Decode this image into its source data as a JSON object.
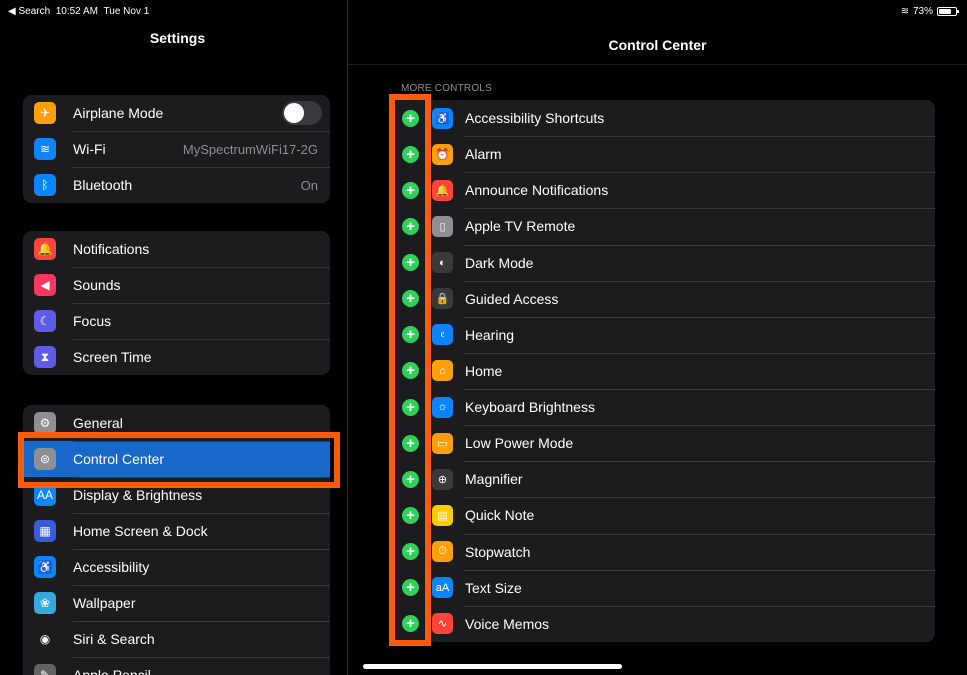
{
  "status_bar": {
    "back_app": "◀ Search",
    "time": "10:52 AM",
    "date": "Tue Nov 1",
    "wifi_icon": "wifi-icon",
    "battery_percent": "73%",
    "battery_level": 0.73
  },
  "sidebar": {
    "title": "Settings",
    "group1": [
      {
        "label": "Airplane Mode",
        "icon": "airplane-icon",
        "color": "#ff9f0a",
        "glyph": "✈",
        "toggle": false
      },
      {
        "label": "Wi-Fi",
        "icon": "wifi-icon",
        "color": "#0a84ff",
        "glyph": "≋",
        "value": "MySpectrumWiFi17-2G"
      },
      {
        "label": "Bluetooth",
        "icon": "bluetooth-icon",
        "color": "#0a84ff",
        "glyph": "ᛒ",
        "value": "On"
      }
    ],
    "group2": [
      {
        "label": "Notifications",
        "icon": "bell-icon",
        "color": "#ff453a",
        "glyph": "🔔"
      },
      {
        "label": "Sounds",
        "icon": "speaker-icon",
        "color": "#ff375f",
        "glyph": "◀"
      },
      {
        "label": "Focus",
        "icon": "moon-icon",
        "color": "#5e5ce6",
        "glyph": "☾"
      },
      {
        "label": "Screen Time",
        "icon": "hourglass-icon",
        "color": "#5e5ce6",
        "glyph": "⧗"
      }
    ],
    "group3": [
      {
        "label": "General",
        "icon": "gear-icon",
        "color": "#8e8e93",
        "glyph": "⚙"
      },
      {
        "label": "Control Center",
        "icon": "switches-icon",
        "color": "#8e8e93",
        "glyph": "⊜",
        "selected": true
      },
      {
        "label": "Display & Brightness",
        "icon": "text-size-icon",
        "color": "#0a84ff",
        "glyph": "AA"
      },
      {
        "label": "Home Screen & Dock",
        "icon": "grid-icon",
        "color": "#3a5bd9",
        "glyph": "▦"
      },
      {
        "label": "Accessibility",
        "icon": "accessibility-icon",
        "color": "#0a84ff",
        "glyph": "♿"
      },
      {
        "label": "Wallpaper",
        "icon": "flower-icon",
        "color": "#34aadc",
        "glyph": "❀"
      },
      {
        "label": "Siri & Search",
        "icon": "siri-icon",
        "color": "#1c1c1e",
        "glyph": "◉"
      },
      {
        "label": "Apple Pencil",
        "icon": "pencil-icon",
        "color": "#636366",
        "glyph": "✎"
      }
    ]
  },
  "main": {
    "title": "Control Center",
    "section_header": "MORE CONTROLS",
    "add_glyph": "+",
    "controls": [
      {
        "label": "Accessibility Shortcuts",
        "icon": "accessibility-icon",
        "color": "#0a84ff",
        "glyph": "♿"
      },
      {
        "label": "Alarm",
        "icon": "alarm-icon",
        "color": "#ff9f0a",
        "glyph": "⏰"
      },
      {
        "label": "Announce Notifications",
        "icon": "announce-icon",
        "color": "#ff453a",
        "glyph": "🔔"
      },
      {
        "label": "Apple TV Remote",
        "icon": "remote-icon",
        "color": "#8e8e93",
        "glyph": "▯"
      },
      {
        "label": "Dark Mode",
        "icon": "dark-mode-icon",
        "color": "#3a3a3c",
        "glyph": "◐"
      },
      {
        "label": "Guided Access",
        "icon": "lock-icon",
        "color": "#3a3a3c",
        "glyph": "🔒"
      },
      {
        "label": "Hearing",
        "icon": "ear-icon",
        "color": "#0a84ff",
        "glyph": "𝔢"
      },
      {
        "label": "Home",
        "icon": "home-icon",
        "color": "#ff9f0a",
        "glyph": "⌂"
      },
      {
        "label": "Keyboard Brightness",
        "icon": "keyboard-brightness-icon",
        "color": "#0a84ff",
        "glyph": "☼"
      },
      {
        "label": "Low Power Mode",
        "icon": "battery-icon",
        "color": "#ff9f0a",
        "glyph": "▭"
      },
      {
        "label": "Magnifier",
        "icon": "magnifier-icon",
        "color": "#3a3a3c",
        "glyph": "⊕"
      },
      {
        "label": "Quick Note",
        "icon": "note-icon",
        "color": "#ffcc00",
        "glyph": "▤"
      },
      {
        "label": "Stopwatch",
        "icon": "stopwatch-icon",
        "color": "#ff9f0a",
        "glyph": "⏱"
      },
      {
        "label": "Text Size",
        "icon": "text-size-icon",
        "color": "#0a84ff",
        "glyph": "aA"
      },
      {
        "label": "Voice Memos",
        "icon": "waveform-icon",
        "color": "#ff453a",
        "glyph": "∿"
      }
    ]
  },
  "colors": {
    "highlight": "#ff5a0a",
    "selected": "#1868c9",
    "add": "#30d158"
  }
}
